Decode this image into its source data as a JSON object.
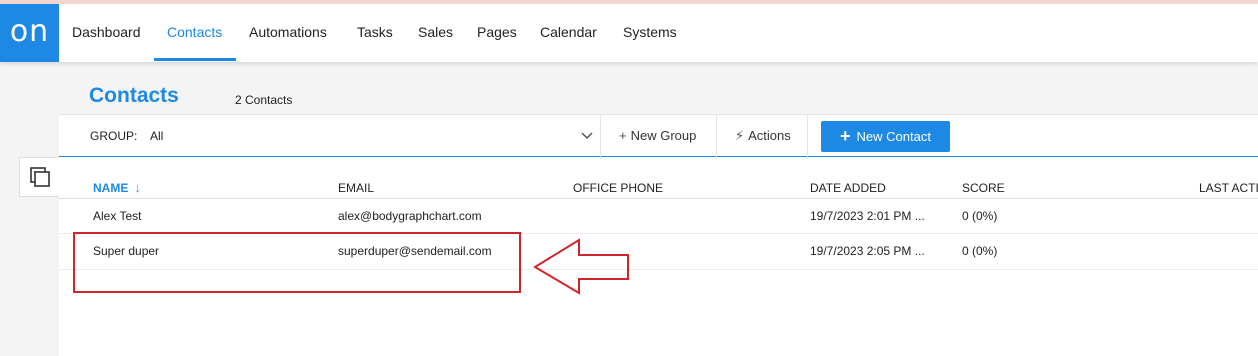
{
  "app": {
    "logo_text": "on"
  },
  "nav": {
    "items": [
      "Dashboard",
      "Contacts",
      "Automations",
      "Tasks",
      "Sales",
      "Pages",
      "Calendar",
      "Systems"
    ],
    "active": "Contacts"
  },
  "page": {
    "title": "Contacts",
    "count": "2 Contacts"
  },
  "toolbar": {
    "group_label": "GROUP:",
    "group_value": "All",
    "new_group": "New Group",
    "actions": "Actions",
    "new_contact": "New Contact"
  },
  "table": {
    "columns": [
      "NAME",
      "EMAIL",
      "OFFICE PHONE",
      "DATE ADDED",
      "SCORE",
      "LAST ACTIV"
    ],
    "sort_indicator": "↓",
    "rows": [
      {
        "name": "Alex Test",
        "email": "alex@bodygraphchart.com",
        "phone": "",
        "date": "19/7/2023 2:01 PM ...",
        "score": "0 (0%)"
      },
      {
        "name": "Super duper",
        "email": "superduper@sendemail.com",
        "phone": "",
        "date": "19/7/2023 2:05 PM ...",
        "score": "0 (0%)"
      }
    ]
  },
  "colors": {
    "accent": "#1e88e5",
    "annotation": "#d0262b"
  },
  "icons": {
    "side": "copy-stack-icon",
    "dropdown": "chevron-down-icon",
    "new_group": "plus-icon",
    "actions": "bolt-icon",
    "new_contact": "plus-icon"
  }
}
